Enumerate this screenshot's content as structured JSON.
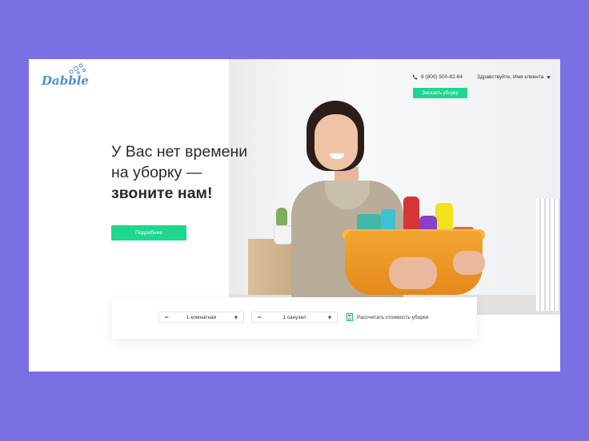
{
  "brand": {
    "logo_text": "Dabble",
    "accent": "#1ed68f",
    "logo_color": "#4a8fd8",
    "background": "#7b70e3"
  },
  "header": {
    "phone": "8 (800) 500-82-64",
    "greeting": "Здравствуйте, Имя клиента",
    "order_button": "Заказать уборку"
  },
  "hero": {
    "line1": "У Вас нет времени",
    "line2": "на уборку —",
    "line3": "звоните нам!",
    "more_button": "Подробнее"
  },
  "calculator": {
    "rooms": {
      "value": "1-комнатная",
      "minus": "−",
      "plus": "+"
    },
    "bathrooms": {
      "value": "1 санузел",
      "minus": "−",
      "plus": "+"
    },
    "action": "Рассчитать стоимость уборки"
  },
  "icons": [
    "phone-icon",
    "chevron-down-icon",
    "calculator-icon",
    "bubbles-icon"
  ]
}
